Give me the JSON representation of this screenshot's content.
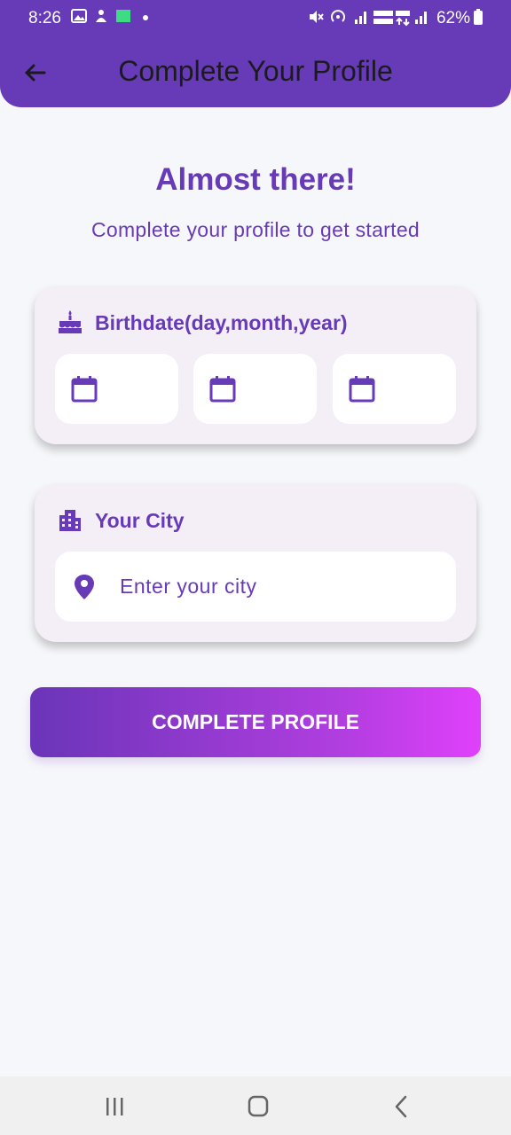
{
  "status_bar": {
    "time": "8:26",
    "battery": "62%"
  },
  "app_bar": {
    "title": "Complete Your Profile"
  },
  "intro": {
    "heading": "Almost there!",
    "subheading": "Complete your profile to get started"
  },
  "birthdate": {
    "label": "Birthdate(day,month,year)"
  },
  "city": {
    "label": "Your City",
    "placeholder": "Enter your city"
  },
  "actions": {
    "complete_label": "COMPLETE PROFILE"
  },
  "colors": {
    "primary": "#673ab7",
    "card_bg": "#f4eff7",
    "gradient_end": "#e040fb"
  }
}
